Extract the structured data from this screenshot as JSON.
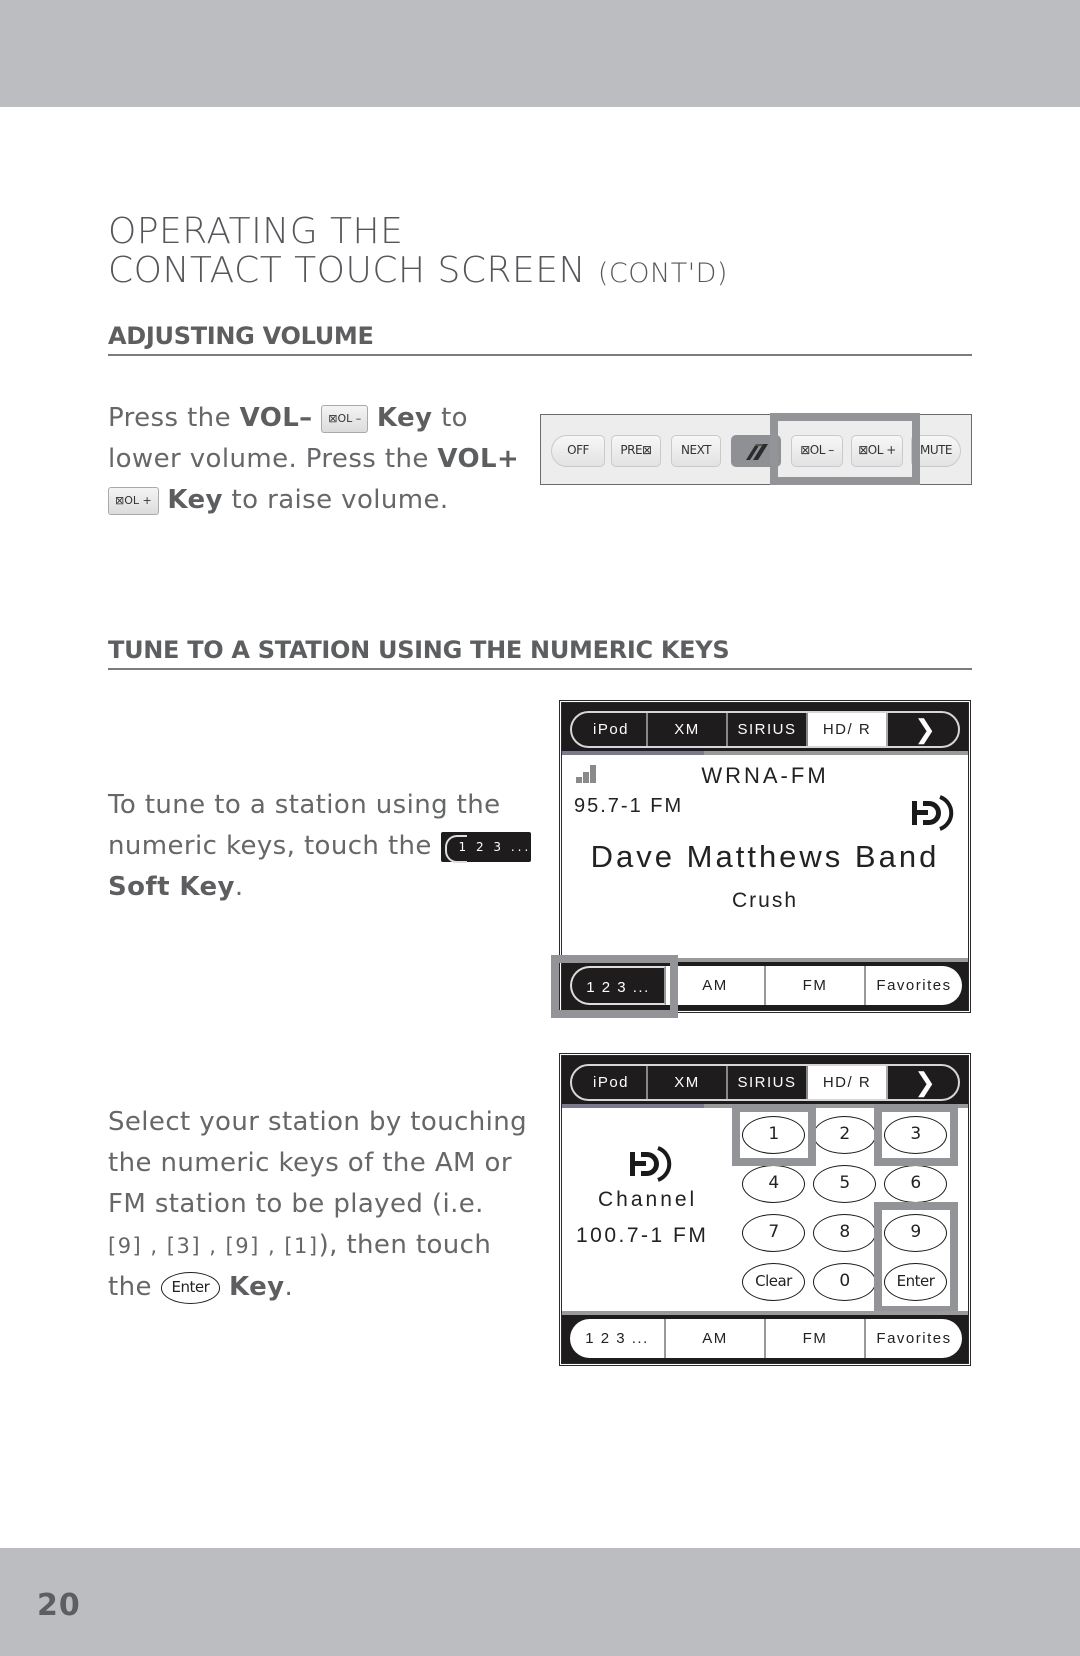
{
  "page": {
    "title_line1": "OPERATING THE",
    "title_line2": "CONTACT TOUCH SCREEN",
    "title_suffix": "(CONT'D)",
    "page_number": "20"
  },
  "volume_section": {
    "heading": "ADJUSTING VOLUME",
    "text": {
      "p1": "Press the ",
      "b1": "VOL–",
      "key_minus": "⊠OL –",
      "b2": "Key",
      "p2": " to",
      "p3": "lower volume. Press the ",
      "b3": "VOL+",
      "key_plus": "⊠OL +",
      "b4": "Key",
      "p4": " to raise volume."
    },
    "control_bar": {
      "buttons": [
        {
          "label": "OFF"
        },
        {
          "label": "PRE⊠"
        },
        {
          "label": "NEXT"
        },
        {
          "label": "",
          "icon": "source-icon"
        },
        {
          "label": "⊠OL –"
        },
        {
          "label": "⊠OL +"
        },
        {
          "label": "MUTE"
        }
      ],
      "highlighted": [
        "⊠OL –",
        "⊠OL +"
      ]
    }
  },
  "tune_section": {
    "heading": "TUNE TO A STATION USING THE NUMERIC KEYS",
    "text1": {
      "p1": "To tune to a station using the",
      "p2": "numeric keys, touch the ",
      "soft_key": "1 2 3 ...",
      "b1": "Soft Key",
      "p3": "."
    },
    "text2": {
      "l1": "Select your station by touching",
      "l2": "the numeric keys of the AM or",
      "l3": "FM station to be played (i.e.",
      "seq": "[9] , [3] , [9] , [1]",
      "l4": "), then touch",
      "l5": "the ",
      "enter_key": "Enter",
      "b1": "Key",
      "p_end": "."
    },
    "screen1": {
      "tabs": [
        "iPod",
        "XM",
        "SIRIUS",
        "HD/ R"
      ],
      "active_tab": "HD/ R",
      "next_icon": "❯",
      "signal_icon": "signal-strength-icon",
      "callsign": "WRNA-FM",
      "frequency": "95.7-1 FM",
      "artist": "Dave Matthews Band",
      "song": "Crush",
      "bottom_tabs": [
        "1 2 3 ...",
        "AM",
        "FM",
        "Favorites"
      ],
      "highlighted_bottom_tab": "1 2 3 ..."
    },
    "screen2": {
      "tabs": [
        "iPod",
        "XM",
        "SIRIUS",
        "HD/ R"
      ],
      "active_tab": "HD/ R",
      "next_icon": "❯",
      "channel_label": "Channel",
      "frequency": "100.7-1 FM",
      "keypad": [
        "1",
        "2",
        "3",
        "4",
        "5",
        "6",
        "7",
        "8",
        "9",
        "Clear",
        "0",
        "Enter"
      ],
      "highlighted_keys": [
        "1",
        "3",
        "9",
        "Enter"
      ],
      "bottom_tabs": [
        "1 2 3 ...",
        "AM",
        "FM",
        "Favorites"
      ]
    }
  }
}
